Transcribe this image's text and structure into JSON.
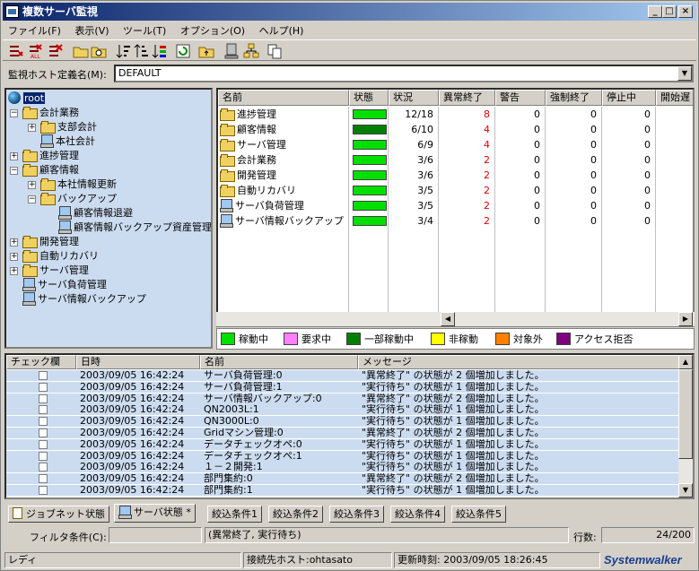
{
  "window": {
    "title": "複数サーバ監視"
  },
  "menu": [
    "ファイル(F)",
    "表示(V)",
    "ツール(T)",
    "オプション(O)",
    "ヘルプ(H)"
  ],
  "host": {
    "label": "監視ホスト定義名(M):",
    "value": "DEFAULT"
  },
  "tree": {
    "root": "root",
    "items": [
      {
        "label": "会計業務",
        "type": "folder",
        "expanded": true
      },
      {
        "label": "支部会計",
        "type": "folder",
        "expanded": false
      },
      {
        "label": "本社会計",
        "type": "host"
      },
      {
        "label": "進捗管理",
        "type": "folder",
        "expanded": false
      },
      {
        "label": "顧客情報",
        "type": "folder",
        "expanded": true
      },
      {
        "label": "本社情報更新",
        "type": "folder",
        "expanded": false
      },
      {
        "label": "バックアップ",
        "type": "folder",
        "expanded": true
      },
      {
        "label": "顧客情報退避",
        "type": "host"
      },
      {
        "label": "顧客情報バックアップ資産管理",
        "type": "host"
      },
      {
        "label": "開発管理",
        "type": "folder",
        "expanded": false
      },
      {
        "label": "自動リカバリ",
        "type": "folder",
        "expanded": false
      },
      {
        "label": "サーバ管理",
        "type": "folder",
        "expanded": false
      },
      {
        "label": "サーバ負荷管理",
        "type": "host"
      },
      {
        "label": "サーバ情報バックアップ",
        "type": "host"
      }
    ]
  },
  "grid": {
    "headers": [
      "名前",
      "状態",
      "状況",
      "異常終了",
      "警告",
      "強制終了",
      "停止中",
      "開始遅"
    ],
    "rows": [
      {
        "name": "進捗管理",
        "type": "folder",
        "status": "稼動中",
        "progress": "12/18",
        "abnormal": "8",
        "warning": "0",
        "forced": "0",
        "stopped": "0"
      },
      {
        "name": "顧客情報",
        "type": "folder",
        "status": "一部稼動中",
        "progress": "6/10",
        "abnormal": "4",
        "warning": "0",
        "forced": "0",
        "stopped": "0"
      },
      {
        "name": "サーバ管理",
        "type": "folder",
        "status": "稼動中",
        "progress": "6/9",
        "abnormal": "4",
        "warning": "0",
        "forced": "0",
        "stopped": "0"
      },
      {
        "name": "会計業務",
        "type": "folder",
        "status": "稼動中",
        "progress": "3/6",
        "abnormal": "2",
        "warning": "0",
        "forced": "0",
        "stopped": "0"
      },
      {
        "name": "開発管理",
        "type": "folder",
        "status": "稼動中",
        "progress": "3/6",
        "abnormal": "2",
        "warning": "0",
        "forced": "0",
        "stopped": "0"
      },
      {
        "name": "自動リカバリ",
        "type": "folder",
        "status": "稼動中",
        "progress": "3/5",
        "abnormal": "2",
        "warning": "0",
        "forced": "0",
        "stopped": "0"
      },
      {
        "name": "サーバ負荷管理",
        "type": "host",
        "status": "稼動中",
        "progress": "3/5",
        "abnormal": "2",
        "warning": "0",
        "forced": "0",
        "stopped": "0"
      },
      {
        "name": "サーバ情報バックアップ",
        "type": "host",
        "status": "稼動中",
        "progress": "3/4",
        "abnormal": "2",
        "warning": "0",
        "forced": "0",
        "stopped": "0"
      }
    ]
  },
  "legend": [
    {
      "label": "稼動中",
      "color": "#00e000"
    },
    {
      "label": "要求中",
      "color": "#ff80ff"
    },
    {
      "label": "一部稼動中",
      "color": "#008000"
    },
    {
      "label": "非稼動",
      "color": "#ffff00"
    },
    {
      "label": "対象外",
      "color": "#ff8000"
    },
    {
      "label": "アクセス拒否",
      "color": "#800080"
    }
  ],
  "messages": {
    "headers": [
      "チェック欄",
      "日時",
      "名前",
      "メッセージ"
    ],
    "rows": [
      {
        "time": "2003/09/05 16:42:24",
        "name": "サーバ負荷管理:0",
        "msg": "\"異常終了\" の状態が 2 個増加しました。"
      },
      {
        "time": "2003/09/05 16:42:24",
        "name": "サーバ負荷管理:1",
        "msg": "\"実行待ち\" の状態が 1 個増加しました。"
      },
      {
        "time": "2003/09/05 16:42:24",
        "name": "サーバ情報バックアップ:0",
        "msg": "\"異常終了\" の状態が 2 個増加しました。"
      },
      {
        "time": "2003/09/05 16:42:24",
        "name": "QN2003L:1",
        "msg": "\"実行待ち\" の状態が 1 個増加しました。"
      },
      {
        "time": "2003/09/05 16:42:24",
        "name": "QN3000L:0",
        "msg": "\"実行待ち\" の状態が 1 個増加しました。"
      },
      {
        "time": "2003/09/05 16:42:24",
        "name": "Gridマシン管理:0",
        "msg": "\"異常終了\" の状態が 2 個増加しました。"
      },
      {
        "time": "2003/09/05 16:42:24",
        "name": "データチェックオペ:0",
        "msg": "\"実行待ち\" の状態が 1 個増加しました。"
      },
      {
        "time": "2003/09/05 16:42:24",
        "name": "データチェックオペ:1",
        "msg": "\"実行待ち\" の状態が 1 個増加しました。"
      },
      {
        "time": "2003/09/05 16:42:24",
        "name": "１－２開発:1",
        "msg": "\"実行待ち\" の状態が 1 個増加しました。"
      },
      {
        "time": "2003/09/05 16:42:24",
        "name": "部門集約:0",
        "msg": "\"異常終了\" の状態が 2 個増加しました。"
      },
      {
        "time": "2003/09/05 16:42:24",
        "name": "部門集約:1",
        "msg": "\"実行待ち\" の状態が 1 個増加しました。"
      }
    ]
  },
  "tabs": [
    "ジョブネット状態",
    "サーバ状態 *",
    "絞込条件1",
    "絞込条件2",
    "絞込条件3",
    "絞込条件4",
    "絞込条件5"
  ],
  "filter": {
    "label": "フィルタ条件(C):",
    "value": "(異常終了, 実行待ち)",
    "count_label": "行数:",
    "count": "24/200"
  },
  "status": {
    "ready": "レディ",
    "host": "接続先ホスト:ohtasato",
    "updated": "更新時刻: 2003/09/05 18:26:45",
    "brand": "Systemwalker"
  }
}
